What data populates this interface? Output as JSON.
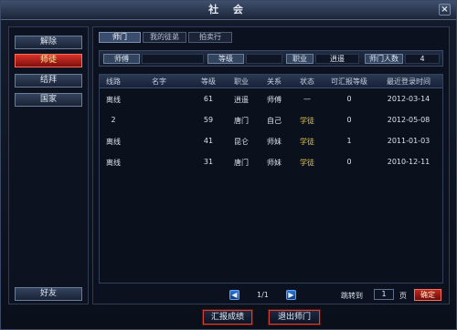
{
  "window": {
    "title": "社 会",
    "close_label": "×"
  },
  "sidebar": {
    "items": [
      {
        "label": "解除",
        "active": false
      },
      {
        "label": "师徒",
        "active": true
      },
      {
        "label": "结拜",
        "active": false
      },
      {
        "label": "国家",
        "active": false
      }
    ],
    "bottom_item": {
      "label": "好友"
    }
  },
  "tabs": [
    {
      "label": "师门",
      "active": true
    },
    {
      "label": "我的徒弟",
      "active": false
    },
    {
      "label": "拍卖行",
      "active": false
    }
  ],
  "info": {
    "master_label": "师傅",
    "master_value": "",
    "level_label": "等级",
    "level_value": "",
    "class_label": "职业",
    "class_value": "逍遥",
    "count_label": "师门人数",
    "count_value": "4"
  },
  "table": {
    "headers": [
      "线路",
      "名字",
      "等级",
      "职业",
      "关系",
      "状态",
      "可汇报等级",
      "最近登录时间"
    ],
    "rows": [
      [
        "离线",
        "",
        "61",
        "逍遥",
        "师傅",
        "—",
        "0",
        "2012-03-14"
      ],
      [
        "2",
        "",
        "59",
        "唐门",
        "自己",
        "学徒",
        "0",
        "2012-05-08"
      ],
      [
        "离线",
        "",
        "41",
        "昆仑",
        "师妹",
        "学徒",
        "1",
        "2011-01-03"
      ],
      [
        "离线",
        "",
        "31",
        "唐门",
        "师妹",
        "学徒",
        "0",
        "2010-12-11"
      ]
    ]
  },
  "pager": {
    "prev_icon": "◀",
    "next_icon": "▶",
    "page_text": "1/1",
    "jump_label": "跳转到",
    "jump_value": "1",
    "page_unit": "页",
    "confirm_label": "确定"
  },
  "actions": {
    "report_label": "汇报成绩",
    "leave_label": "退出师门"
  },
  "colors": {
    "accent_red": "#d8332a",
    "status_yellow": "#e4c44a",
    "frame_blue": "#2e3c55"
  }
}
